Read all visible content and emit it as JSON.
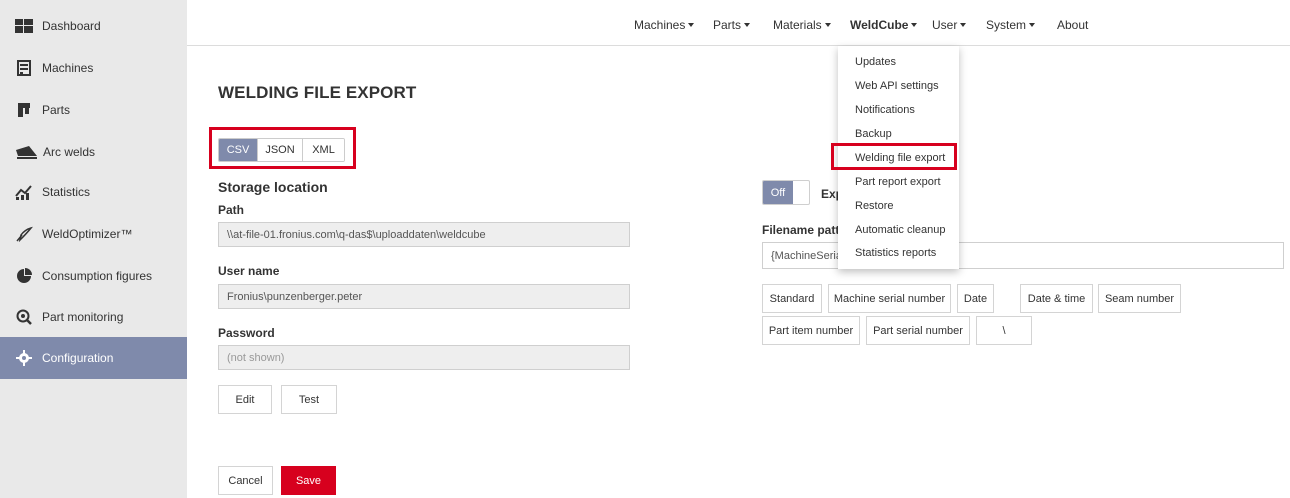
{
  "sidebar": {
    "items": [
      {
        "label": "Dashboard",
        "icon": "dashboard-icon"
      },
      {
        "label": "Machines",
        "icon": "machine-icon"
      },
      {
        "label": "Parts",
        "icon": "parts-icon"
      },
      {
        "label": "Arc welds",
        "icon": "arc-weld-icon"
      },
      {
        "label": "Statistics",
        "icon": "statistics-icon"
      },
      {
        "label": "WeldOptimizer™",
        "icon": "weld-optimizer-icon"
      },
      {
        "label": "Consumption figures",
        "icon": "pie-chart-icon"
      },
      {
        "label": "Part monitoring",
        "icon": "search-icon"
      },
      {
        "label": "Configuration",
        "icon": "gear-icon"
      }
    ],
    "active": "Configuration",
    "active_color": "#7f8aab"
  },
  "topnav": {
    "items": [
      "Machines",
      "Parts",
      "Materials",
      "WeldCube",
      "User",
      "System",
      "About"
    ],
    "active": "WeldCube"
  },
  "dropdown": {
    "items": [
      "Updates",
      "Web API settings",
      "Notifications",
      "Backup",
      "Welding file export",
      "Part report export",
      "Restore",
      "Automatic cleanup",
      "Statistics reports"
    ],
    "highlighted": "Welding file export"
  },
  "page": {
    "title": "WELDING FILE EXPORT",
    "formats": [
      "CSV",
      "JSON",
      "XML"
    ],
    "active_format": "CSV",
    "storage_title": "Storage location",
    "path_label": "Path",
    "path_value": "\\\\at-file-01.fronius.com\\q-das$\\uploaddaten\\weldcube",
    "user_label": "User name",
    "user_value": "Fronius\\punzenberger.peter",
    "password_label": "Password",
    "password_placeholder": "(not shown)",
    "edit_label": "Edit",
    "test_label": "Test",
    "cancel_label": "Cancel",
    "save_label": "Save",
    "toggle_label": "Off",
    "export_label": "Exp",
    "filename_label": "Filename patte",
    "filename_value": "{MachineSeria",
    "chips": [
      "Standard",
      "Machine serial number",
      "Date",
      "Date & time",
      "Seam number",
      "Part item number",
      "Part serial number",
      "\\"
    ]
  },
  "colors": {
    "accent": "#7f8aab",
    "highlight": "#d7001e",
    "save": "#d7001e"
  }
}
